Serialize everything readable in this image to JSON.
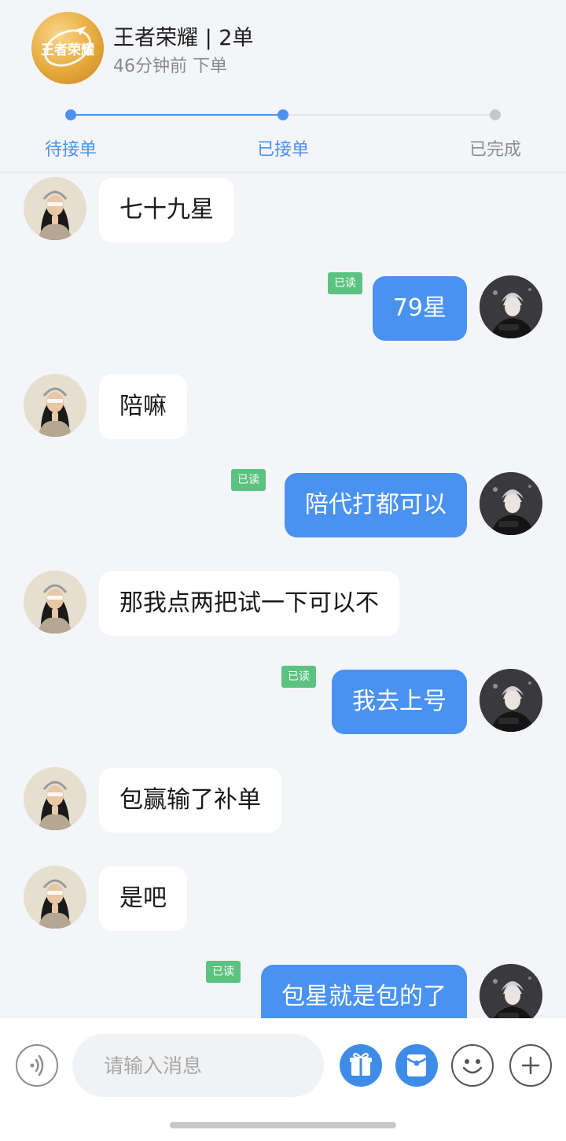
{
  "order": {
    "game_title": "王者荣耀 | 2单",
    "time": "46分钟前 下单",
    "logo_text": "王者荣耀"
  },
  "progress": {
    "steps": [
      {
        "label": "待接单",
        "state": "done"
      },
      {
        "label": "已接单",
        "state": "current"
      },
      {
        "label": "已完成",
        "state": "pending"
      }
    ],
    "colors": {
      "active": "#4a92f0",
      "inactive": "#8e8e8e"
    }
  },
  "chat": {
    "read_label": "已读",
    "messages": [
      {
        "from": "other",
        "text": "七十九星"
      },
      {
        "from": "me",
        "text": "79星",
        "read": true
      },
      {
        "from": "other",
        "text": "陪嘛"
      },
      {
        "from": "me",
        "text": "陪代打都可以",
        "read": true
      },
      {
        "from": "other",
        "text": "那我点两把试一下可以不"
      },
      {
        "from": "me",
        "text": "我去上号",
        "read": true
      },
      {
        "from": "other",
        "text": "包赢输了补单"
      },
      {
        "from": "other",
        "text": "是吧"
      },
      {
        "from": "me",
        "text": "包星就是包的了",
        "read": true
      }
    ]
  },
  "input": {
    "placeholder": "请输入消息"
  },
  "icons": [
    "voice-icon",
    "gift-icon",
    "red-packet-icon",
    "emoji-icon",
    "plus-icon"
  ]
}
